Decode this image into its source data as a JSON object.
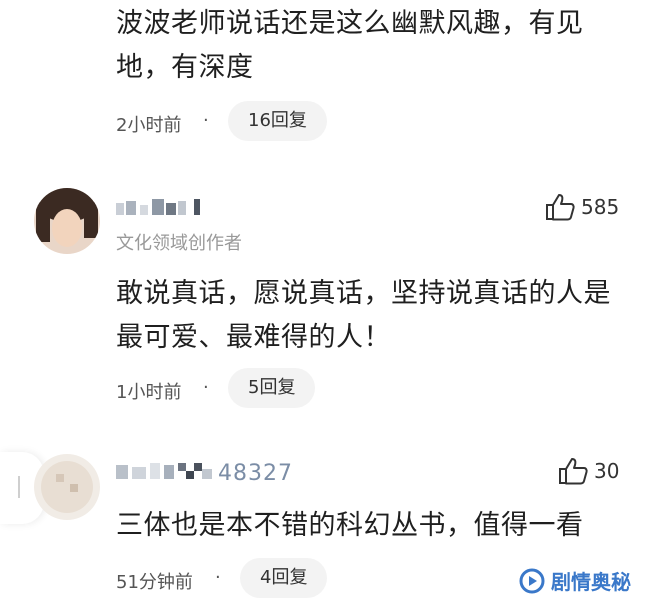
{
  "comments": [
    {
      "text_line1": "波波老师说话还是这么幽默风趣，有见",
      "text_line2": "地，有深度",
      "time": "2小时前",
      "dot": "·",
      "replies": "16回复"
    },
    {
      "username": "",
      "subtitle": "文化领域创作者",
      "likes": "585",
      "text_line1": "敢说真话，愿说真话，坚持说真话的人是",
      "text_line2": "最可爱、最难得的人！",
      "time": "1小时前",
      "dot": "·",
      "replies": "5回复"
    },
    {
      "username_suffix": "48327",
      "likes": "30",
      "text_line1": "三体也是本不错的科幻丛书，值得一看",
      "time": "51分钟前",
      "dot": "·",
      "replies": "4回复"
    }
  ],
  "watermark": {
    "text": "剧情奥秘",
    "color": "#3a78c9"
  },
  "icons": {
    "like": "thumbs-up-icon",
    "watermark_logo": "play-logo-icon"
  }
}
